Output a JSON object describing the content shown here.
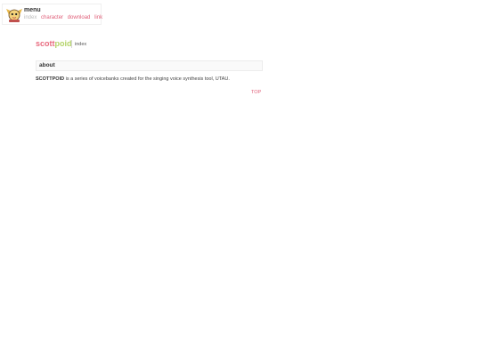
{
  "menu": {
    "title": "menu",
    "links": [
      {
        "label": "index",
        "current": true
      },
      {
        "label": "character",
        "current": false
      },
      {
        "label": "download",
        "current": false
      },
      {
        "label": "link",
        "current": false
      }
    ]
  },
  "header": {
    "logo_part1": "scott",
    "logo_part2": "poid",
    "page_label": "index"
  },
  "about": {
    "heading": "about",
    "brand": "SCOTTPOID",
    "text": " is a series of voicebanks created for the singing voice synthesis tool, UTAU."
  },
  "top_link": "TOP",
  "colors": {
    "link_pink": "#e0607a",
    "logo_pink": "#e86b7f",
    "logo_green": "#b5d46a"
  }
}
